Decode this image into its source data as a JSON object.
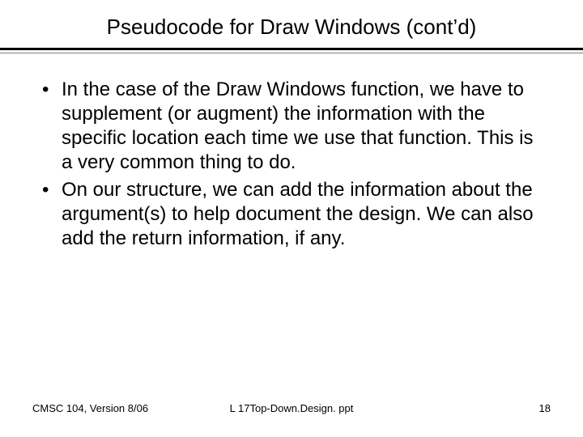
{
  "title": "Pseudocode for Draw Windows (cont’d)",
  "bullets": [
    "In the case of the Draw Windows function, we have to supplement (or augment) the information with the specific location each time we use that function.  This is a very common thing to do.",
    "On our structure, we can add the information about the argument(s) to help document the design.  We can also add the return information, if any."
  ],
  "footer": {
    "left": "CMSC 104, Version 8/06",
    "center": "L 17Top-Down.Design. ppt",
    "right": "18"
  }
}
